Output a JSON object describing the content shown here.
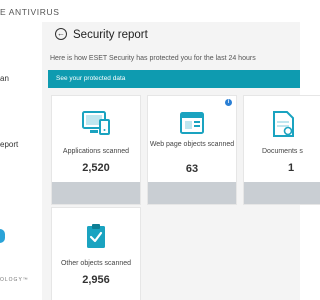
{
  "app": {
    "brand": "E ANTIVIRUS"
  },
  "sidebar": {
    "items": [
      {
        "label": "an"
      },
      {
        "label": "eport"
      }
    ],
    "footer": "OLOGY™"
  },
  "report": {
    "title": "Security report",
    "subtitle": "Here is how ESET Security has protected you for the last 24 hours",
    "banner": "See your protected data"
  },
  "cards": [
    {
      "label": "Applications scanned",
      "value": "2,520",
      "icon": "applications-icon"
    },
    {
      "label": "Web page objects scanned",
      "value": "63",
      "icon": "web-page-icon"
    },
    {
      "label": "Documents s",
      "value": "1",
      "icon": "documents-icon"
    },
    {
      "label": "Other objects scanned",
      "value": "2,956",
      "icon": "other-objects-icon"
    }
  ],
  "colors": {
    "accent": "#0e9bb0",
    "icon": "#1aa3c0",
    "card_footer": "#c9ced3"
  }
}
